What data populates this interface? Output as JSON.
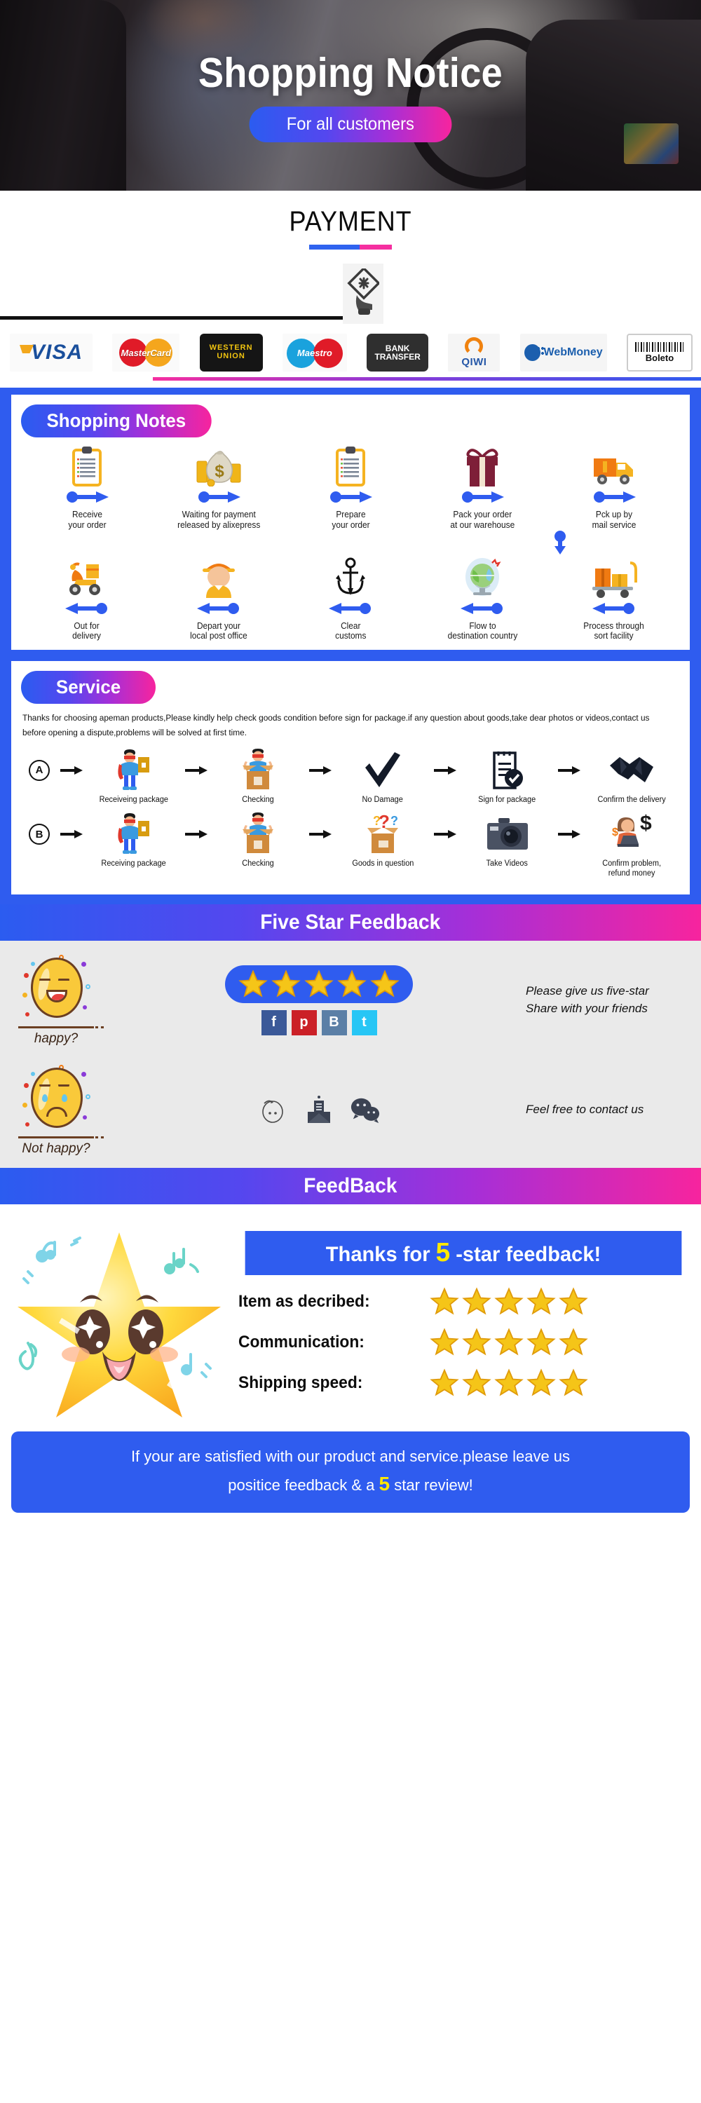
{
  "hero": {
    "title": "Shopping Notice",
    "pill_label": "For all customers"
  },
  "payment": {
    "title": "PAYMENT",
    "methods": [
      {
        "name": "VISA",
        "label": "VISA"
      },
      {
        "name": "MasterCard",
        "label": "MasterCard"
      },
      {
        "name": "Western Union",
        "line1": "WESTERN",
        "line2": "UNION"
      },
      {
        "name": "Maestro",
        "label": "Maestro"
      },
      {
        "name": "Bank Transfer",
        "line1": "BANK",
        "line2": "TRANSFER"
      },
      {
        "name": "QIWI",
        "label": "QIWI"
      },
      {
        "name": "WebMoney",
        "label": "WebMoney"
      },
      {
        "name": "Boleto",
        "label": "Boleto"
      }
    ]
  },
  "shopping_notes": {
    "badge": "Shopping Notes",
    "row1": [
      {
        "icon": "clipboard-icon",
        "label": "Receive\nyour order"
      },
      {
        "icon": "money-bag-icon",
        "label": "Waiting for payment\nreleased by alixepress"
      },
      {
        "icon": "clipboard-icon",
        "label": "Prepare\nyour order"
      },
      {
        "icon": "gift-box-icon",
        "label": "Pack your order\nat our warehouse"
      },
      {
        "icon": "delivery-truck-icon",
        "label": "Pck up by\nmail service"
      }
    ],
    "row2": [
      {
        "icon": "scooter-icon",
        "label": "Out for\ndelivery"
      },
      {
        "icon": "postman-icon",
        "label": "Depart your\nlocal post office"
      },
      {
        "icon": "anchor-icon",
        "label": "Clear\ncustoms"
      },
      {
        "icon": "globe-icon",
        "label": "Flow to\ndestination country"
      },
      {
        "icon": "cart-boxes-icon",
        "label": "Process through\nsort facility"
      }
    ]
  },
  "service": {
    "badge": "Service",
    "text": "Thanks for choosing apeman products,Please kindly help check goods condition before sign for package.if any question about goods,take dear photos or videos,contact us before opening a dispute,problems will be solved at first time.",
    "flow_a": {
      "letter": "A",
      "steps": [
        {
          "icon": "hero-package-icon",
          "label": "Receiveing package"
        },
        {
          "icon": "hero-open-box-icon",
          "label": "Checking"
        },
        {
          "icon": "checkmark-icon",
          "label": "No Damage"
        },
        {
          "icon": "sign-document-icon",
          "label": "Sign for package"
        },
        {
          "icon": "handshake-icon",
          "label": "Confirm the delivery"
        }
      ]
    },
    "flow_b": {
      "letter": "B",
      "steps": [
        {
          "icon": "hero-package-icon",
          "label": "Receiving package"
        },
        {
          "icon": "hero-open-box-icon",
          "label": "Checking"
        },
        {
          "icon": "question-box-icon",
          "label": "Goods in question"
        },
        {
          "icon": "camera-icon",
          "label": "Take Videos"
        },
        {
          "icon": "refund-agent-icon",
          "label": "Confirm problem,\nrefund money"
        }
      ]
    }
  },
  "five_star": {
    "band_title": "Five Star Feedback",
    "happy_caption": "happy?",
    "not_happy_caption": "Not happy?",
    "star_count": 5,
    "socials": [
      {
        "name": "facebook-icon",
        "glyph": "f"
      },
      {
        "name": "pinterest-icon",
        "glyph": "p"
      },
      {
        "name": "vk-icon",
        "glyph": "B"
      },
      {
        "name": "twitter-icon",
        "glyph": "t"
      }
    ],
    "message_line1": "Please give us five-star",
    "message_line2": "Share with your friends",
    "contact_icons": [
      "skype-icon",
      "email-icon",
      "wechat-icon"
    ],
    "contact_message": "Feel free to contact us"
  },
  "feedback": {
    "band_title": "FeedBack",
    "thanks_prefix": "Thanks for ",
    "thanks_number": "5",
    "thanks_suffix": " -star feedback!",
    "ratings": [
      {
        "label": "Item as decribed:",
        "stars": 5
      },
      {
        "label": "Communication:",
        "stars": 5
      },
      {
        "label": "Shipping speed:",
        "stars": 5
      }
    ],
    "cta_line1": "If your are satisfied with our product and service.please leave us",
    "cta_mid": "positice feedback & a ",
    "cta_number": "5",
    "cta_end": " star review!"
  },
  "colors": {
    "brand_blue": "#2f5cef",
    "brand_pink": "#f7249e",
    "gold": "#ffe800",
    "gray_bg": "#eaeaea"
  }
}
